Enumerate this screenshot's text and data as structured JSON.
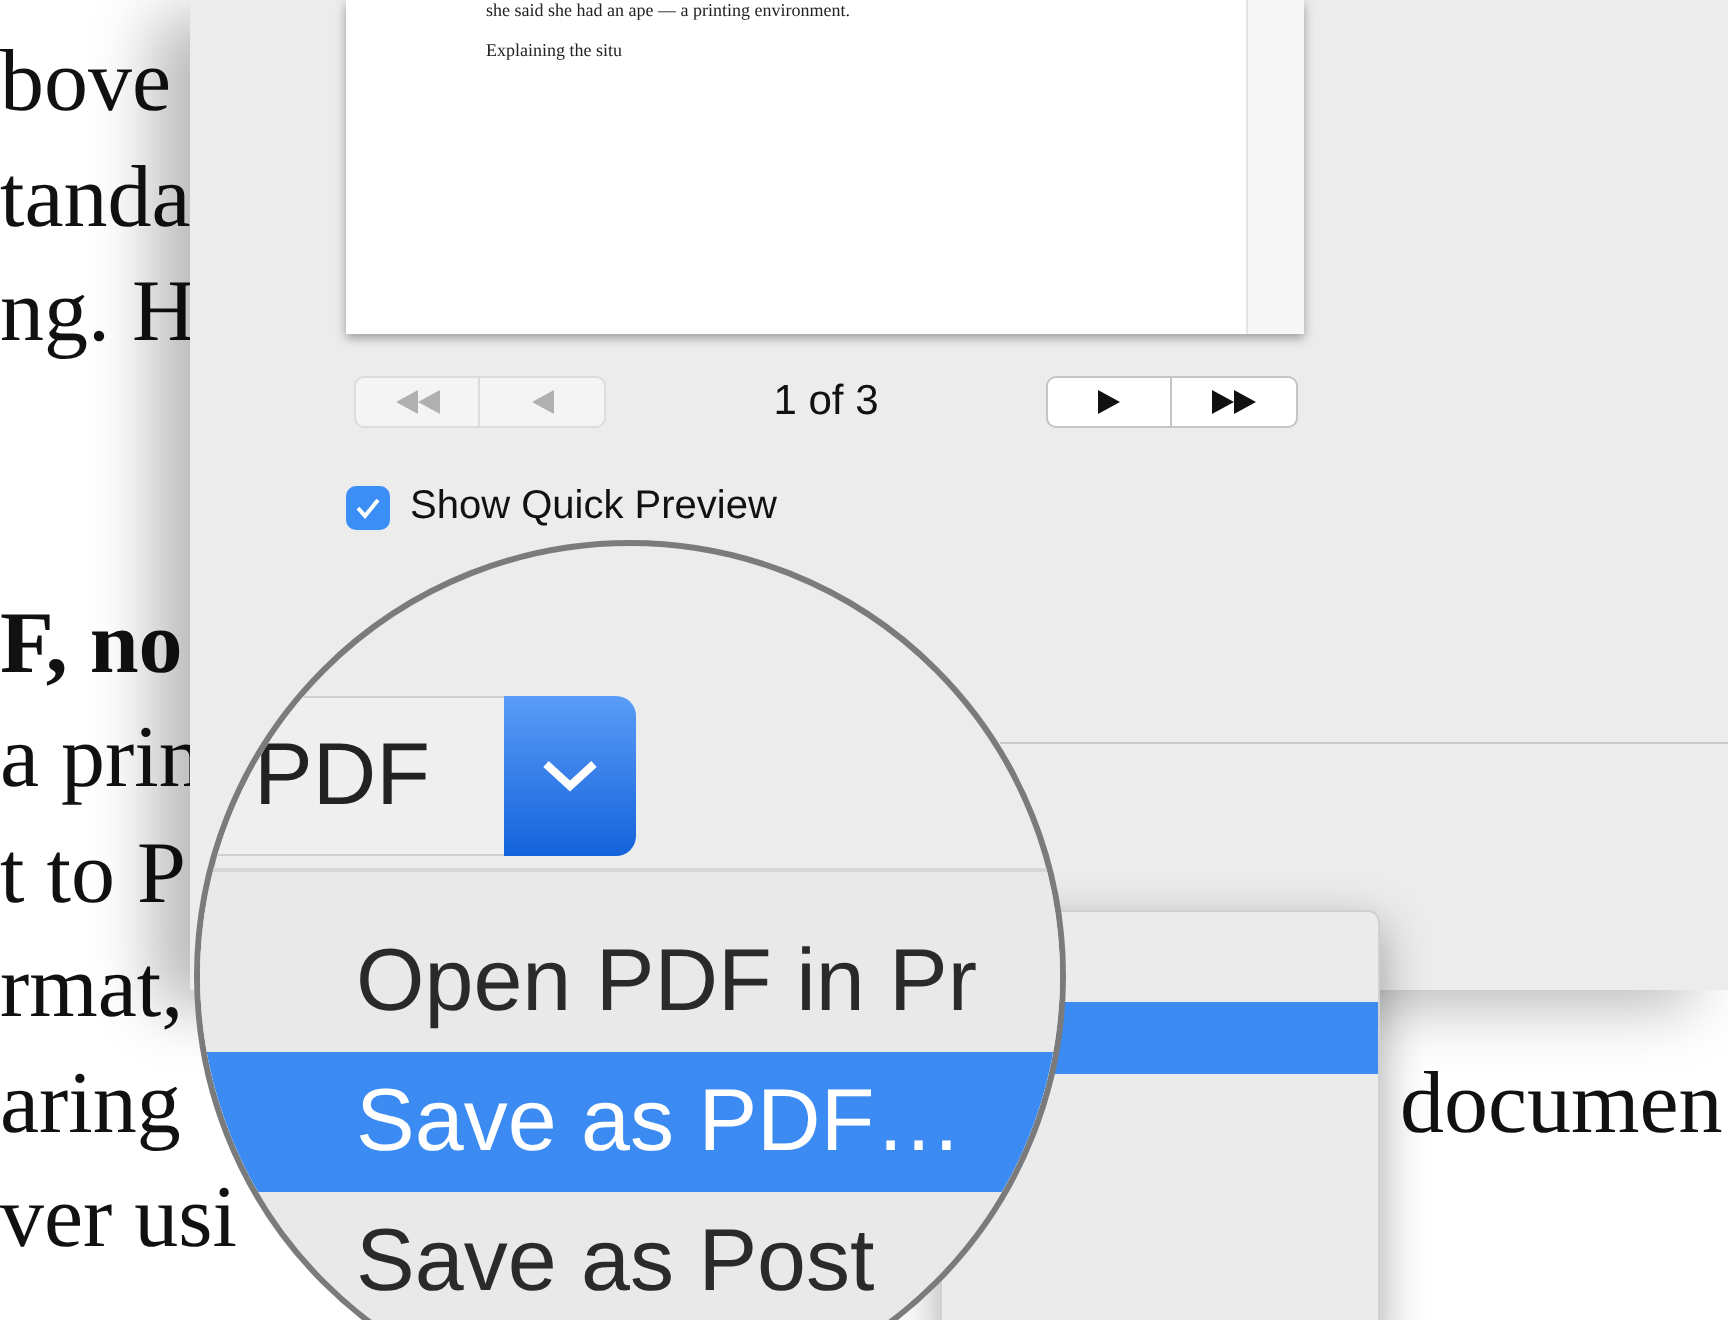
{
  "background_document": {
    "paragraphs": [
      {
        "lines": [
          {
            "kind": "body",
            "text": "bove"
          },
          {
            "kind": "body",
            "text": "tanda"
          },
          {
            "kind": "body",
            "text": "ng. H"
          }
        ]
      },
      {
        "lines": [
          {
            "kind": "heading",
            "text": "F, no"
          },
          {
            "kind": "body",
            "text": "a prin"
          },
          {
            "kind": "body",
            "text": "t to P"
          },
          {
            "kind": "body",
            "text": "rmat,"
          },
          {
            "kind": "body",
            "text": "aring",
            "right": "documen"
          },
          {
            "kind": "body",
            "text": "ver usi"
          }
        ]
      }
    ]
  },
  "print_dialog": {
    "preview_lines": [
      "she said she had an ape — a printing environment.",
      "Explaining the situ"
    ],
    "page_nav": {
      "page_label": "1 of 3",
      "back_enabled": false,
      "forward_enabled": true
    },
    "show_quick_preview": {
      "label": "Show Quick Preview",
      "checked": true
    }
  },
  "magnifier": {
    "pdf_button": {
      "label": "PDF"
    },
    "menu_items": [
      {
        "label": "Open PDF in Pr",
        "selected": false
      },
      {
        "label": "Save as PDF…",
        "selected": true
      },
      {
        "label": "Save as Post",
        "selected": false
      }
    ]
  }
}
